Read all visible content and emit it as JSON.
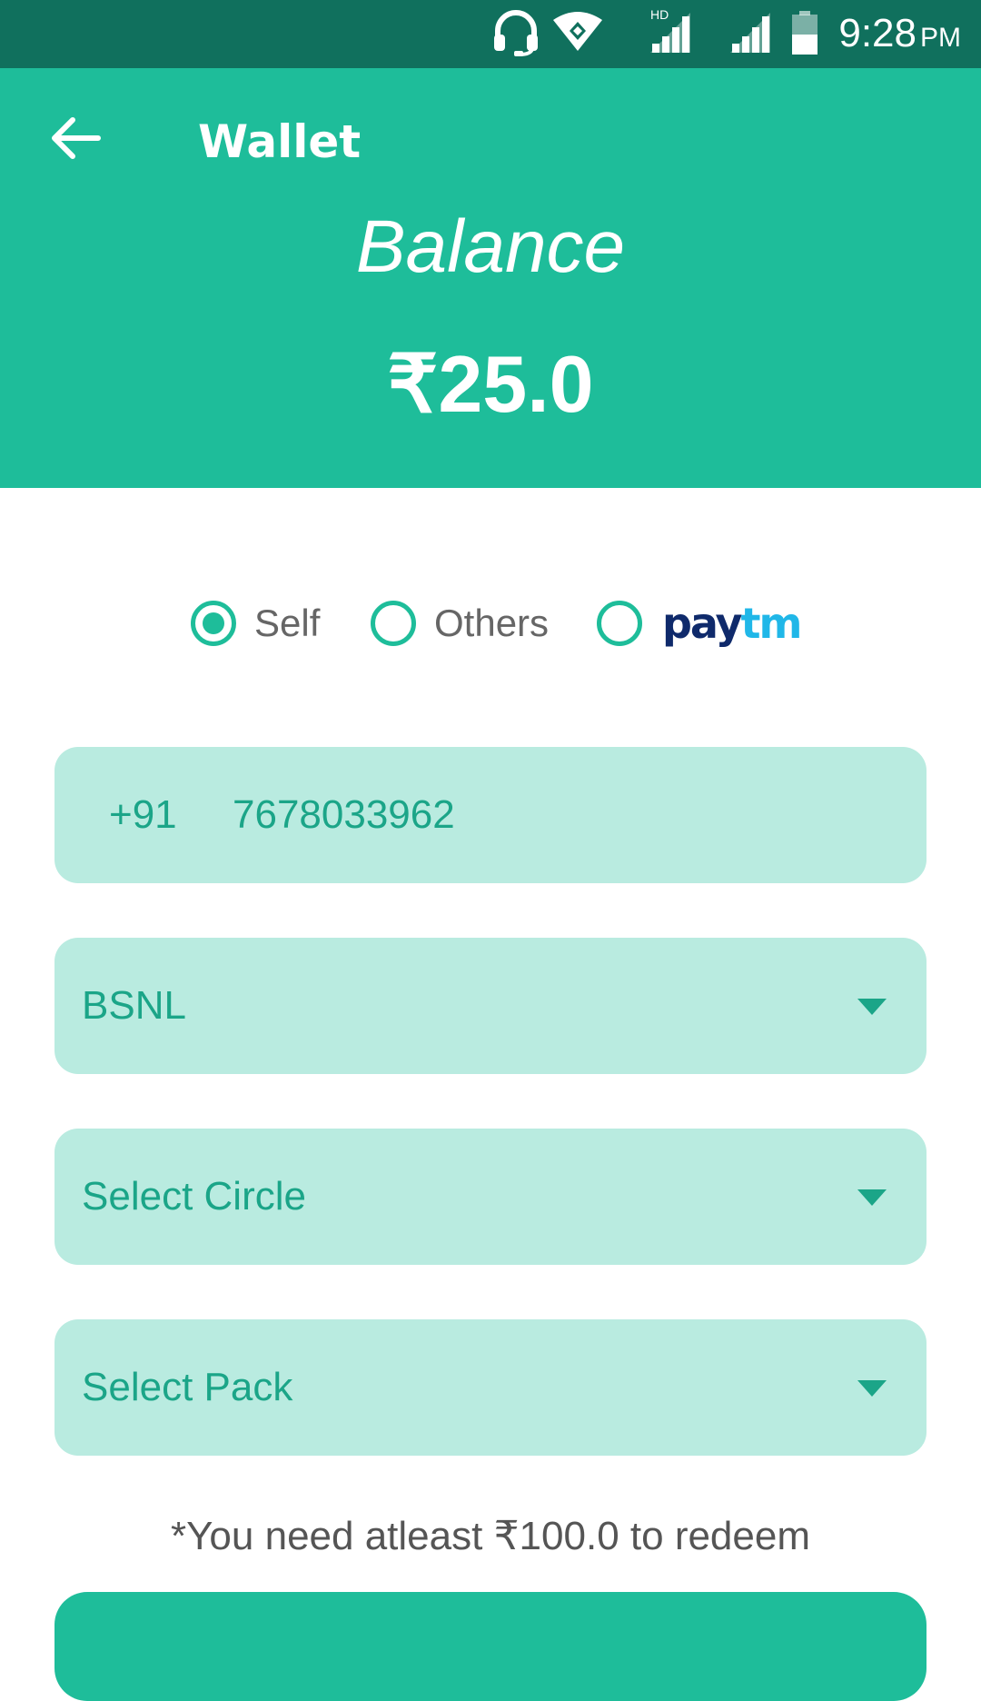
{
  "status_bar": {
    "time": "9:28",
    "ampm": "PM",
    "hd_label": "HD",
    "icons": [
      "headset-icon",
      "wifi-icon",
      "hd-signal-icon",
      "signal-icon",
      "battery-icon"
    ]
  },
  "header": {
    "title": "Wallet",
    "balance_label": "Balance",
    "balance_amount": "₹25.0",
    "background_color": "#1ebd9a"
  },
  "recharge_for": {
    "options": [
      {
        "label": "Self",
        "selected": true
      },
      {
        "label": "Others",
        "selected": false
      },
      {
        "label": "paytm",
        "selected": false
      }
    ],
    "paytm_logo": {
      "pay": "pay",
      "tm": "tm"
    }
  },
  "form": {
    "country_code": "+91",
    "phone_number": "7678033962",
    "operator": "BSNL",
    "circle_placeholder": "Select Circle",
    "pack_placeholder": "Select Pack"
  },
  "note": "*You need atleast ₹100.0 to redeem",
  "colors": {
    "accent": "#1ebd9a",
    "status_bar": "#10705d",
    "field_background": "#b9ebe0",
    "field_text": "#1ba588"
  }
}
